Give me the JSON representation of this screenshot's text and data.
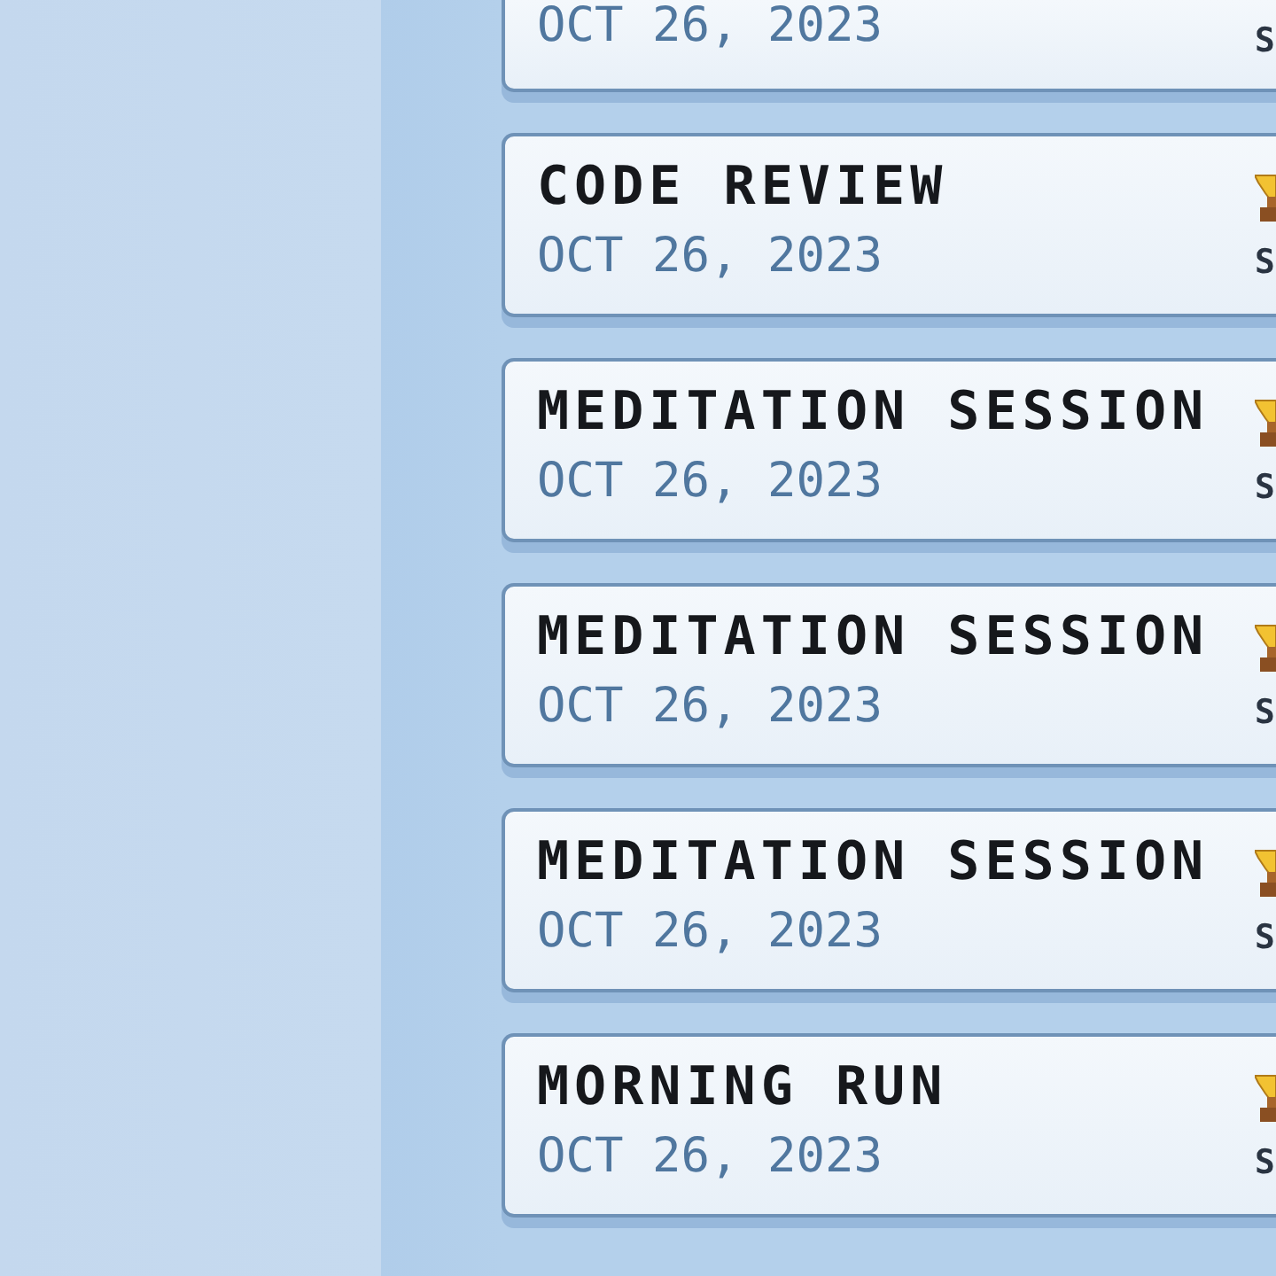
{
  "entries": [
    {
      "date": "OCT 26, 2023",
      "side_text": "S"
    },
    {
      "title": "CODE REVIEW",
      "date": "OCT 26, 2023",
      "side_text": "S"
    },
    {
      "title": "MEDITATION SESSION",
      "date": "OCT 26, 2023",
      "side_text": "S"
    },
    {
      "title": "MEDITATION SESSION",
      "date": "OCT 26, 2023",
      "side_text": "S"
    },
    {
      "title": "MEDITATION SESSION",
      "date": "OCT 26, 2023",
      "side_text": "S"
    },
    {
      "title": "MORNING RUN",
      "date": "OCT 26, 2023",
      "side_text": "S"
    }
  ]
}
